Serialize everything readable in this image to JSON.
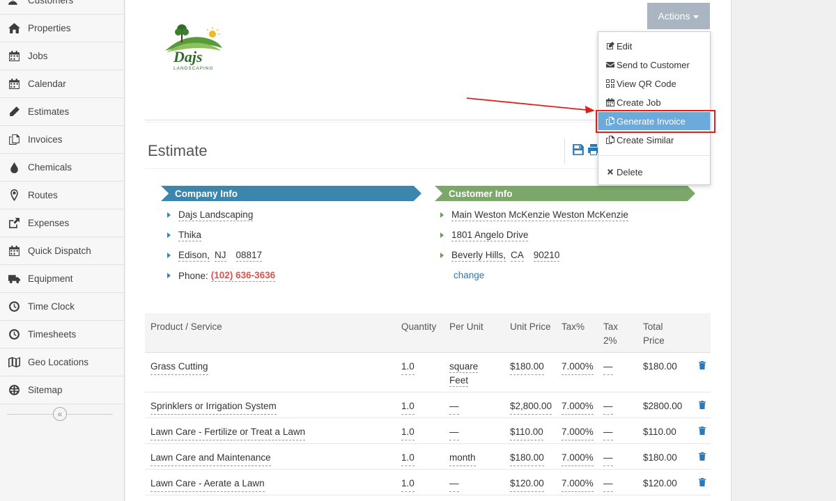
{
  "sidebar": {
    "items": [
      {
        "label": "Customers",
        "icon": "users-icon"
      },
      {
        "label": "Properties",
        "icon": "home-icon"
      },
      {
        "label": "Jobs",
        "icon": "calendar-grid-icon"
      },
      {
        "label": "Calendar",
        "icon": "calendar-grid-icon"
      },
      {
        "label": "Estimates",
        "icon": "pencil-icon"
      },
      {
        "label": "Invoices",
        "icon": "copy-icon"
      },
      {
        "label": "Chemicals",
        "icon": "droplet-icon"
      },
      {
        "label": "Routes",
        "icon": "map-pin-icon"
      },
      {
        "label": "Expenses",
        "icon": "share-icon"
      },
      {
        "label": "Quick Dispatch",
        "icon": "calendar-grid-icon"
      },
      {
        "label": "Equipment",
        "icon": "truck-icon"
      },
      {
        "label": "Time Clock",
        "icon": "clock-icon"
      },
      {
        "label": "Timesheets",
        "icon": "clock-icon"
      },
      {
        "label": "Geo Locations",
        "icon": "map-icon"
      },
      {
        "label": "Sitemap",
        "icon": "globe-icon"
      }
    ],
    "collapse_glyph": "«"
  },
  "header": {
    "actions_label": "Actions",
    "logo_text": "Dajs",
    "logo_subtext": "LANDSCAPING"
  },
  "dropdown": {
    "items": [
      {
        "label": "Edit",
        "icon": "edit-icon"
      },
      {
        "label": "Send to Customer",
        "icon": "envelope-icon"
      },
      {
        "label": "View QR Code",
        "icon": "qrcode-icon"
      },
      {
        "label": "Create Job",
        "icon": "calendar-icon"
      },
      {
        "label": "Generate Invoice",
        "icon": "copy-icon",
        "active": true
      },
      {
        "label": "Create Similar",
        "icon": "copy-icon"
      },
      {
        "label": "Delete",
        "icon": "close-icon"
      }
    ]
  },
  "estimate": {
    "title": "Estimate",
    "company_info_label": "Company Info",
    "customer_info_label": "Customer Info",
    "company": {
      "name": "Dajs Landscaping",
      "street": "Thika",
      "city": "Edison,",
      "state": "NJ",
      "zip": "08817",
      "phone_label": "Phone:",
      "phone": "(102) 636-3636"
    },
    "customer": {
      "name": "Main Weston McKenzie Weston McKenzie",
      "street": "1801 Angelo Drive",
      "city": "Beverly Hills,",
      "state": "CA",
      "zip": "90210",
      "change_label": "change"
    }
  },
  "table": {
    "headers": {
      "product": "Product / Service",
      "quantity": "Quantity",
      "per_unit": "Per Unit",
      "unit_price": "Unit Price",
      "tax_pct": "Tax%",
      "tax2_line1": "Tax",
      "tax2_line2": "2%",
      "total_line1": "Total",
      "total_line2": "Price"
    },
    "rows": [
      {
        "product": "Grass Cutting",
        "quantity": "1.0",
        "per_unit": "square",
        "per_unit2": "Feet",
        "unit_price": "$180.00",
        "tax": "7.000%",
        "tax2": "—",
        "total": "$180.00"
      },
      {
        "product": "Sprinklers or Irrigation System",
        "quantity": "1.0",
        "per_unit": "—",
        "per_unit2": "",
        "unit_price": "$2,800.00",
        "tax": "7.000%",
        "tax2": "—",
        "total": "$2800.00"
      },
      {
        "product": "Lawn Care - Fertilize or Treat a Lawn",
        "quantity": "1.0",
        "per_unit": "—",
        "per_unit2": "",
        "unit_price": "$110.00",
        "tax": "7.000%",
        "tax2": "—",
        "total": "$110.00"
      },
      {
        "product": "Lawn Care and Maintenance",
        "quantity": "1.0",
        "per_unit": "month",
        "per_unit2": "",
        "unit_price": "$180.00",
        "tax": "7.000%",
        "tax2": "—",
        "total": "$180.00"
      },
      {
        "product": "Lawn Care - Aerate a Lawn",
        "quantity": "1.0",
        "per_unit": "—",
        "per_unit2": "",
        "unit_price": "$120.00",
        "tax": "7.000%",
        "tax2": "—",
        "total": "$120.00"
      }
    ]
  },
  "colors": {
    "company_ribbon": "#3a86ad",
    "customer_ribbon": "#7ba86a",
    "actions_button": "#a9b6c1",
    "active_menu": "#6aaadc",
    "highlight": "#e01e1e",
    "phone": "#d9534f",
    "link": "#2a7ab8"
  }
}
